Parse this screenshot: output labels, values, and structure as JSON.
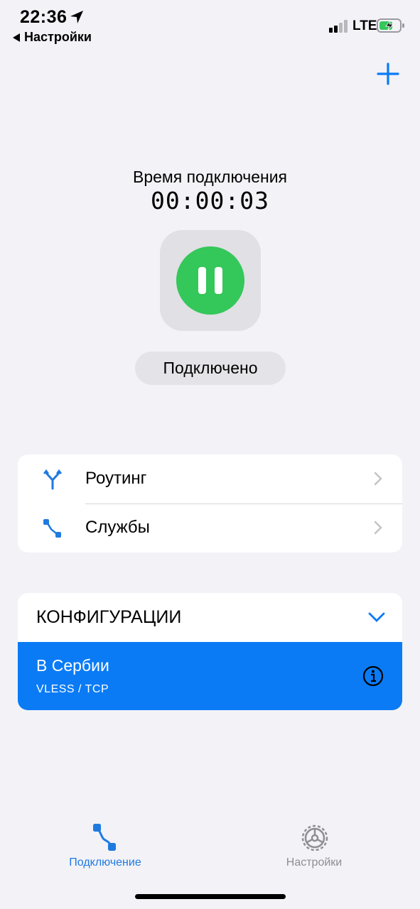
{
  "status_bar": {
    "time": "22:36",
    "back_label": "Настройки",
    "network": "LTE",
    "battery_color": "#34c759"
  },
  "header": {
    "add_icon": "plus-icon",
    "accent_color": "#0a7bf5"
  },
  "connection": {
    "label": "Время подключения",
    "timer": "00:00:03",
    "button_icon": "pause-icon",
    "button_color": "#34c759",
    "status": "Подключено"
  },
  "menu": {
    "items": [
      {
        "label": "Роутинг",
        "icon": "routing-icon"
      },
      {
        "label": "Службы",
        "icon": "services-icon"
      }
    ]
  },
  "configs": {
    "header": "КОНФИГУРАЦИИ",
    "selected": {
      "name": "В Сербии",
      "protocol": "VLESS / TCP",
      "icon": "info-icon"
    }
  },
  "tabbar": {
    "tabs": [
      {
        "label": "Подключение",
        "icon": "connection-icon",
        "active": true
      },
      {
        "label": "Настройки",
        "icon": "gear-icon",
        "active": false
      }
    ]
  }
}
